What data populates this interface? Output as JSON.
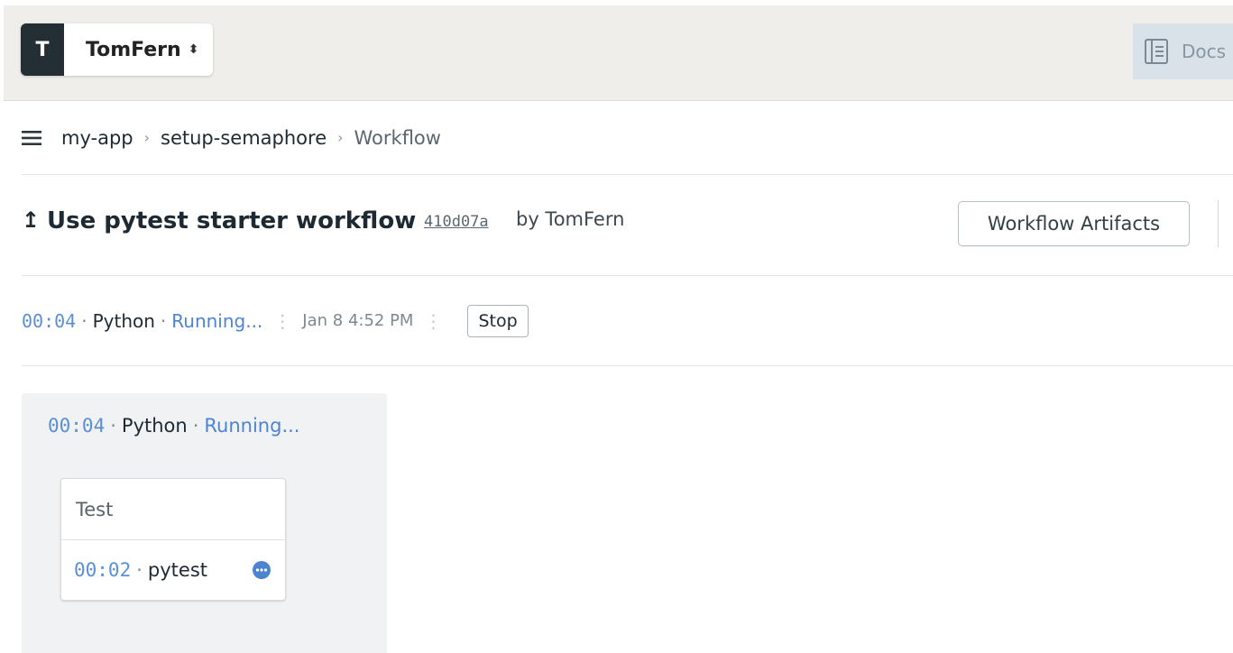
{
  "org": {
    "initial": "T",
    "name": "TomFern",
    "caret": "⬍"
  },
  "header": {
    "docs_label": "Docs"
  },
  "breadcrumb": {
    "project": "my-app",
    "branch": "setup-semaphore",
    "current": "Workflow",
    "separator": "›"
  },
  "workflow": {
    "arrow": "↥",
    "title": "Use pytest starter workflow",
    "commit": "410d07a",
    "by_author": "by TomFern",
    "artifacts_label": "Workflow Artifacts"
  },
  "status": {
    "duration": "00:04",
    "dot": "·",
    "pipeline": "Python",
    "state": "Running...",
    "meta_separator": "⋮",
    "started": "Jan 8 4:52 PM",
    "stop_label": "Stop"
  },
  "pipeline": {
    "duration": "00:04",
    "name": "Python",
    "state": "Running...",
    "blocks": [
      {
        "name": "Test",
        "jobs": [
          {
            "duration": "00:02",
            "name": "pytest",
            "status_icon": "running-dots-icon"
          }
        ]
      }
    ]
  },
  "colors": {
    "accent_blue": "#4d84d1",
    "topbar_bg": "#efeeea",
    "panel_bg": "#f1f2f4"
  }
}
